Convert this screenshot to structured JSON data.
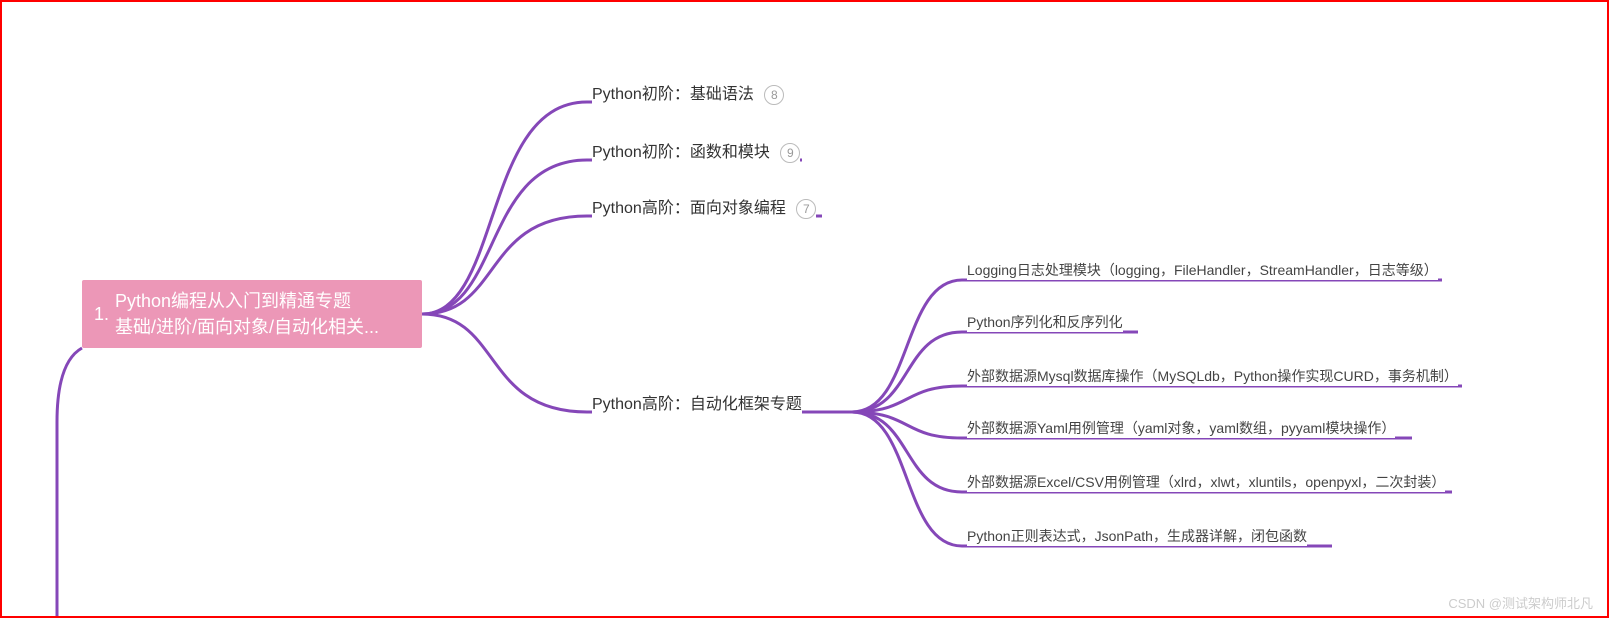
{
  "root": {
    "number": "1.",
    "line1": "Python编程从入门到精通专题",
    "line2": "基础/进阶/面向对象/自动化相关..."
  },
  "branch1": {
    "label": "Python初阶：基础语法",
    "badge": "8"
  },
  "branch2": {
    "label": "Python初阶：函数和模块",
    "badge": "9"
  },
  "branch3": {
    "label": "Python高阶：面向对象编程",
    "badge": "7"
  },
  "branch4": {
    "label": "Python高阶：自动化框架专题",
    "leaf1": "Logging日志处理模块（logging，FileHandler，StreamHandler，日志等级）",
    "leaf2": "Python序列化和反序列化",
    "leaf3": "外部数据源Mysql数据库操作（MySQLdb，Python操作实现CURD，事务机制）",
    "leaf4": "外部数据源Yaml用例管理（yaml对象，yaml数组，pyyaml模块操作）",
    "leaf5": "外部数据源Excel/CSV用例管理（xlrd，xlwt，xluntils，openpyxl，二次封装）",
    "leaf6": "Python正则表达式，JsonPath，生成器详解，闭包函数"
  },
  "watermark": "CSDN @测试架构师北凡"
}
